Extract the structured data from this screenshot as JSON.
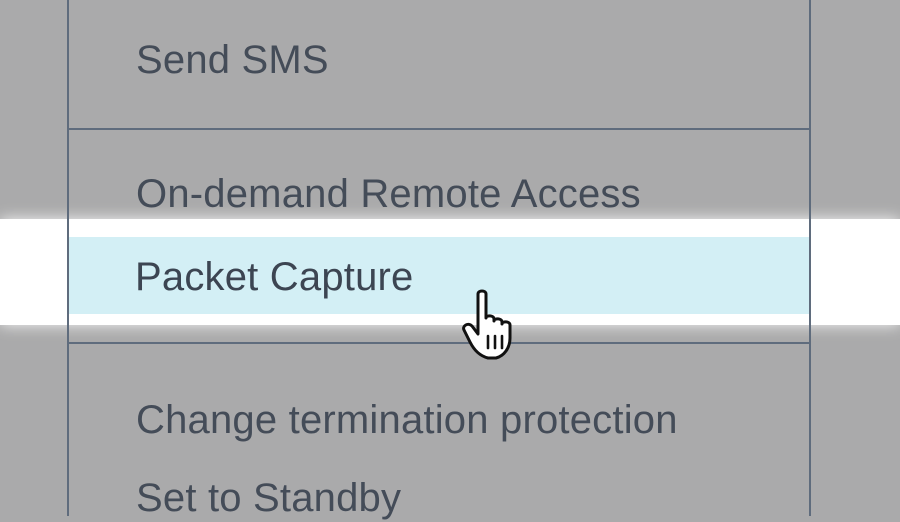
{
  "menu": {
    "items": [
      {
        "label": ""
      },
      {
        "label": "Send SMS"
      },
      {
        "label": "On-demand Remote Access"
      },
      {
        "label": "Packet Capture",
        "state": "hovered"
      },
      {
        "label": "Change termination protection"
      },
      {
        "label": "Set to Standby"
      }
    ]
  },
  "cursor": {
    "icon": "hand-pointer-icon"
  },
  "colors": {
    "overlay": "#aaaaab",
    "spotlight": "#ffffff",
    "hover_background": "#d3eff5",
    "text": "#444c58",
    "border": "#5f6c7d"
  }
}
